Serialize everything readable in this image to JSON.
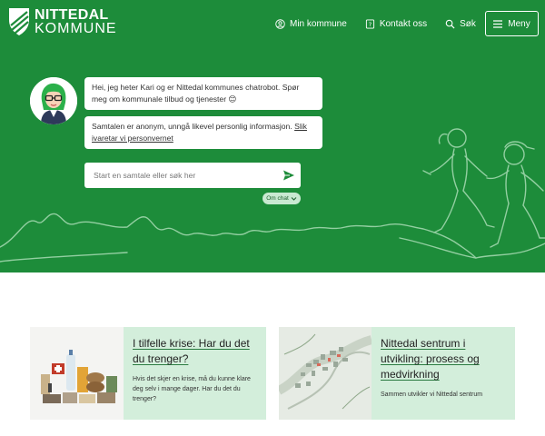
{
  "header": {
    "logo": {
      "line1": "NITTEDAL",
      "line2": "KOMMUNE",
      "icon": "shield-logo-icon"
    },
    "nav": [
      {
        "label": "Min kommune",
        "icon": "user-circle-icon"
      },
      {
        "label": "Kontakt oss",
        "icon": "contact-icon"
      },
      {
        "label": "Søk",
        "icon": "search-icon"
      }
    ],
    "menu_label": "Meny"
  },
  "chat": {
    "bubble1": "Hei, jeg heter Kari og er Nittedal kommunes chatrobot. Spør meg om kommunale tilbud og tjenester 😊",
    "bubble2_text": "Samtalen er anonym, unngå likevel personlig informasjon.",
    "bubble2_link": "Slik ivaretar vi personvernet",
    "input_placeholder": "Start en samtale eller søk her",
    "about_label": "Om chat"
  },
  "cards": [
    {
      "title": "I tilfelle krise: Har du det du trenger?",
      "description": "Hvis det skjer en krise, må du kunne klare deg selv i mange dager. Har du det du trenger?"
    },
    {
      "title": "Nittedal sentrum i utvikling: prosess og medvirkning",
      "description": "Sammen utvikler vi Nittedal sentrum"
    }
  ],
  "colors": {
    "brand_green": "#1d8c3a",
    "card_green": "#d3eedb",
    "white": "#ffffff"
  }
}
